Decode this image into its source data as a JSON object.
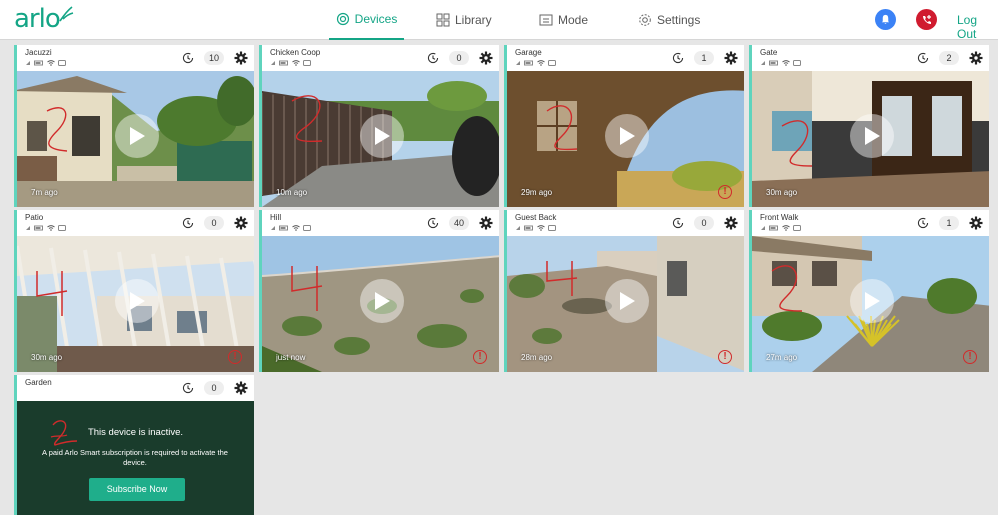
{
  "brand": {
    "name": "arlo",
    "color": "#14a586"
  },
  "nav": {
    "devices": "Devices",
    "library": "Library",
    "mode": "Mode",
    "settings": "Settings"
  },
  "header": {
    "logout": "Log Out"
  },
  "devices": [
    {
      "name": "Jacuzzi",
      "count": "10",
      "ago": "7m ago",
      "alert": false,
      "scene": "jacuzzi"
    },
    {
      "name": "Chicken Coop",
      "count": "0",
      "ago": "10m ago",
      "alert": false,
      "scene": "coop"
    },
    {
      "name": "Garage",
      "count": "1",
      "ago": "29m ago",
      "alert": true,
      "scene": "garage"
    },
    {
      "name": "Gate",
      "count": "2",
      "ago": "30m ago",
      "alert": false,
      "scene": "gate"
    },
    {
      "name": "Patio",
      "count": "0",
      "ago": "30m ago",
      "alert": true,
      "scene": "patio"
    },
    {
      "name": "Hill",
      "count": "40",
      "ago": "just now",
      "alert": true,
      "scene": "hill"
    },
    {
      "name": "Guest Back",
      "count": "0",
      "ago": "28m ago",
      "alert": true,
      "scene": "guest"
    },
    {
      "name": "Front Walk",
      "count": "1",
      "ago": "27m ago",
      "alert": true,
      "scene": "front"
    }
  ],
  "garden": {
    "name": "Garden",
    "count": "0",
    "inactive_title": "This device is inactive.",
    "inactive_body": "A paid Arlo Smart subscription is required to activate the device.",
    "subscribe": "Subscribe Now"
  },
  "alert_glyph": "!",
  "colors": {
    "accent": "#14a586",
    "bell": "#3b82f6",
    "phone": "#d01b2f",
    "inactive_bg": "#1a3c2c"
  }
}
